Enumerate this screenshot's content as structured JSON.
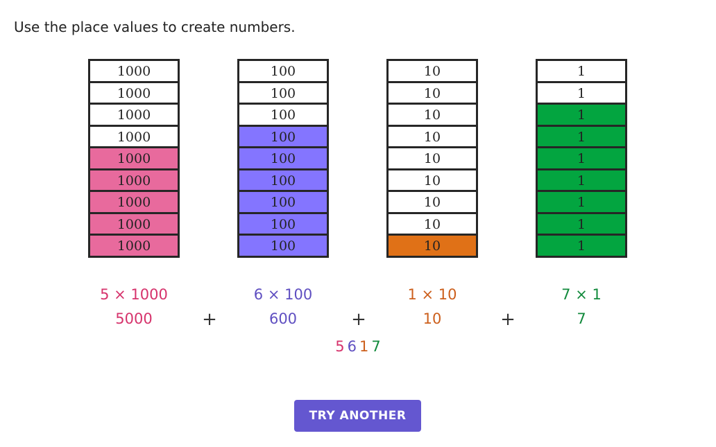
{
  "title": "Use the place values to create numbers.",
  "columns": [
    {
      "place": "thousands",
      "label": "1000",
      "count": 5,
      "total_cells": 9,
      "color": "#e86a9d",
      "text_color": "#d6336c",
      "expr": "5 × 1000",
      "value": "5000",
      "digit": "5"
    },
    {
      "place": "hundreds",
      "label": "100",
      "count": 6,
      "total_cells": 9,
      "color": "#8475ff",
      "text_color": "#5f4fc1",
      "expr": "6 × 100",
      "value": "600",
      "digit": "6"
    },
    {
      "place": "tens",
      "label": "10",
      "count": 1,
      "total_cells": 9,
      "color": "#e07117",
      "text_color": "#cc5f1c",
      "expr": "1 × 10",
      "value": "10",
      "digit": "1"
    },
    {
      "place": "ones",
      "label": "1",
      "count": 7,
      "total_cells": 9,
      "color": "#03a540",
      "text_color": "#128a3c",
      "expr": "7 × 1",
      "value": "7",
      "digit": "7"
    }
  ],
  "plus_sign": "+",
  "result_number": "5617",
  "button": {
    "label": "TRY ANOTHER",
    "color": "#6457d0"
  }
}
